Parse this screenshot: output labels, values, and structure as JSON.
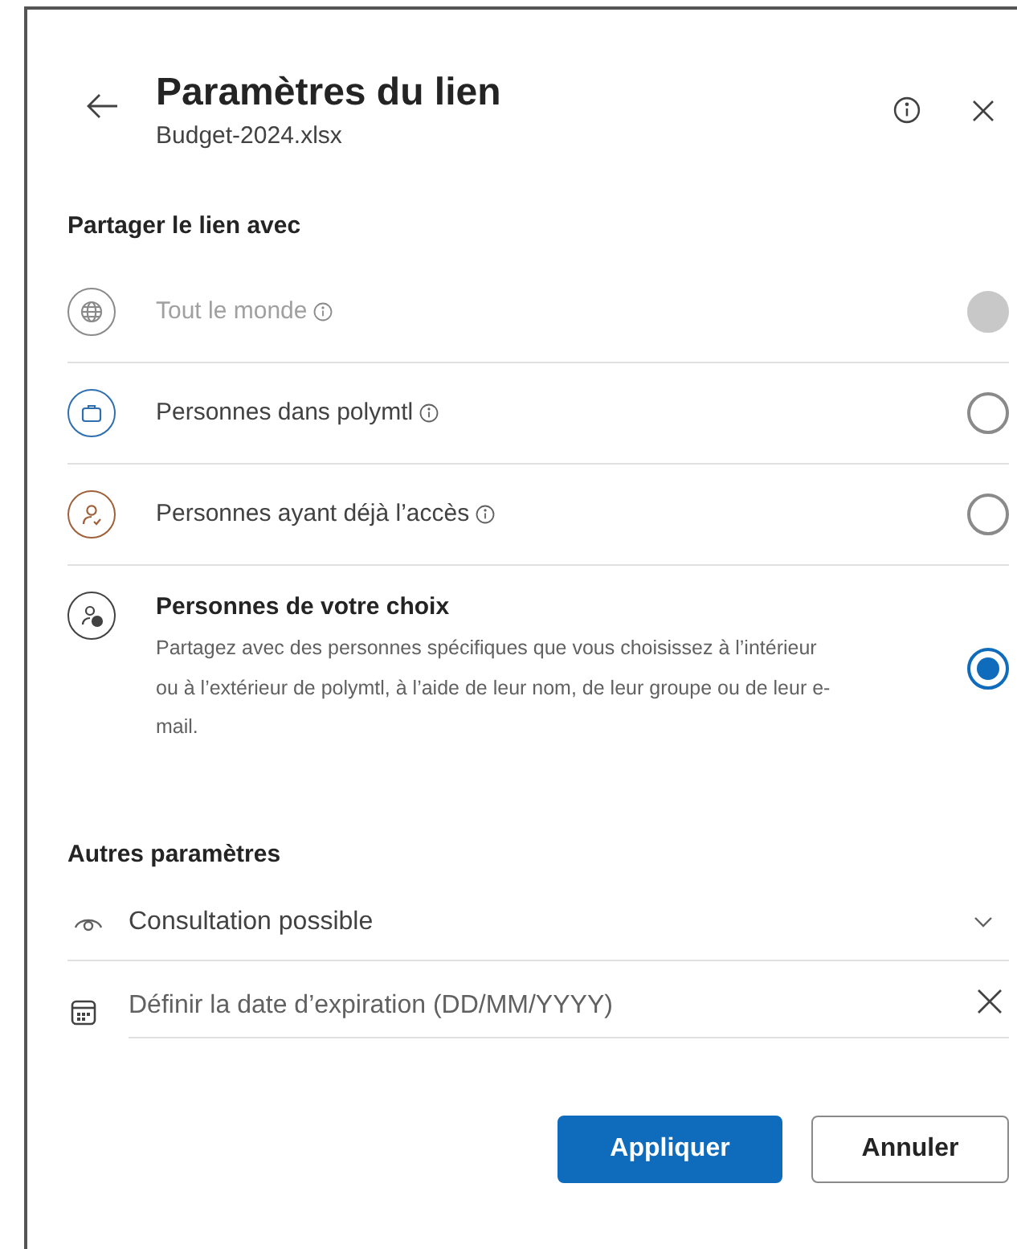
{
  "header": {
    "title": "Paramètres du lien",
    "subtitle": "Budget-2024.xlsx"
  },
  "share_section": {
    "heading": "Partager le lien avec",
    "options": [
      {
        "kind": "globe",
        "label": "Tout le monde",
        "info": true,
        "disabled": true,
        "selected": false,
        "color": "#8a8a8a"
      },
      {
        "kind": "briefcase",
        "label": "Personnes dans polymtl",
        "info": true,
        "disabled": false,
        "selected": false,
        "color": "#2f6fb0"
      },
      {
        "kind": "person-check",
        "label": "Personnes ayant déjà l’accès",
        "info": true,
        "disabled": false,
        "selected": false,
        "color": "#a0603a"
      },
      {
        "kind": "person-add",
        "label": "Personnes de votre choix",
        "info": false,
        "disabled": false,
        "selected": true,
        "color": "#424242",
        "description": "Partagez avec des personnes spécifiques que vous choisissez à l’intérieur ou à l’extérieur de polymtl, à l’aide de leur nom, de leur groupe ou de leur e-mail."
      }
    ]
  },
  "other_section": {
    "heading": "Autres paramètres",
    "permission": {
      "value": "Consultation possible"
    },
    "expiration": {
      "placeholder": "Définir la date d’expiration (DD/MM/YYYY)"
    }
  },
  "buttons": [
    {
      "kind": "primary",
      "label": "Appliquer"
    },
    {
      "kind": "secondary",
      "label": "Annuler"
    }
  ]
}
